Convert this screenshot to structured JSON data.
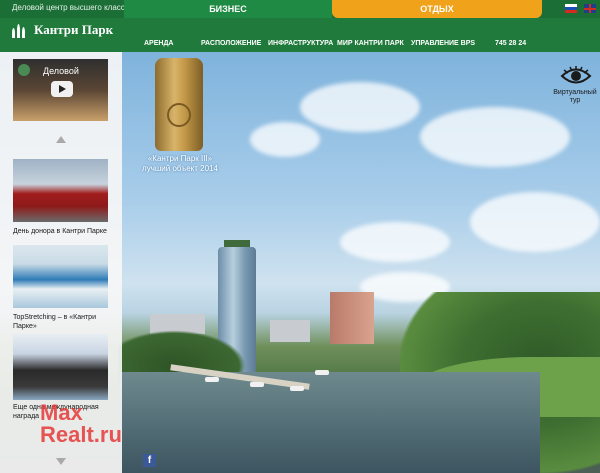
{
  "header": {
    "tagline": "Деловой центр высшего класса",
    "tabs": [
      {
        "label": "БИЗНЕС",
        "active": true
      },
      {
        "label": "ОТДЫХ",
        "active": false
      }
    ],
    "logo_text": "Кантри Парк",
    "languages": [
      "ru",
      "en"
    ]
  },
  "nav": {
    "items": [
      "АРЕНДА",
      "РАСПОЛОЖЕНИЕ",
      "ИНФРАСТРУКТУРА",
      "МИР КАНТРИ ПАРК",
      "УПРАВЛЕНИЕ BPS",
      "745 28 24"
    ]
  },
  "sidebar": {
    "video_title": "Деловой",
    "news": [
      {
        "caption": "День донора в Кантри Парке"
      },
      {
        "caption": "TopStretching – в «Кантри Парке»"
      },
      {
        "caption": "Еще одна международная награда"
      }
    ]
  },
  "award": {
    "caption": "«Кантри Парк III» лучший объект 2014"
  },
  "tour": {
    "label": "Виртуальный тур"
  },
  "watermark": {
    "line1": "Max",
    "line2": "Realt.ru"
  },
  "colors": {
    "header_green": "#1f7a3c",
    "tab_orange": "#f0a21a",
    "facebook_blue": "#3b5998"
  }
}
